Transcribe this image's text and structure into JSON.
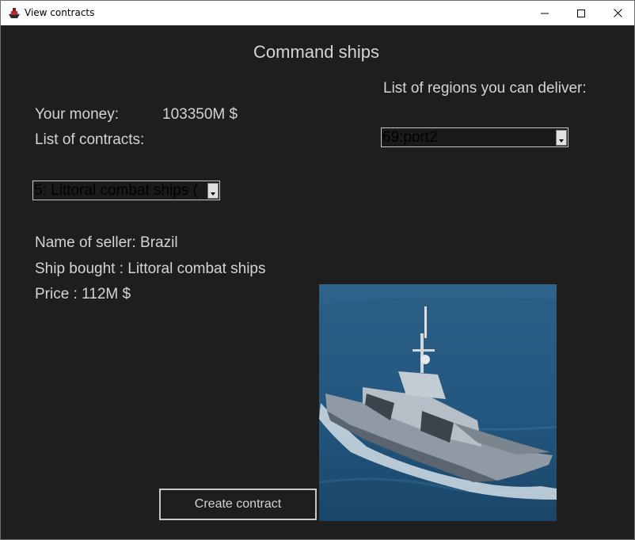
{
  "window": {
    "title": "View contracts",
    "app_icon": "ship-app-icon",
    "controls": {
      "minimize": "minimize-icon",
      "maximize": "maximize-icon",
      "close": "close-icon"
    }
  },
  "heading": "Command ships",
  "money": {
    "label": "Your money:",
    "value": "103350M $"
  },
  "contracts": {
    "label": "List of contracts:",
    "selected": "5: Littoral combat ships ("
  },
  "regions": {
    "label": "List of regions you can deliver:",
    "selected": "69:port2"
  },
  "details": {
    "seller": "Name of seller: Brazil",
    "ship": "Ship bought : Littoral combat ships",
    "price": "Price : 112M $"
  },
  "create_button": "Create contract",
  "ship_image": "littoral-combat-ship-photo",
  "colors": {
    "background": "#1e1e1e",
    "text": "#d4d4d4",
    "border": "#c8c8c8"
  }
}
